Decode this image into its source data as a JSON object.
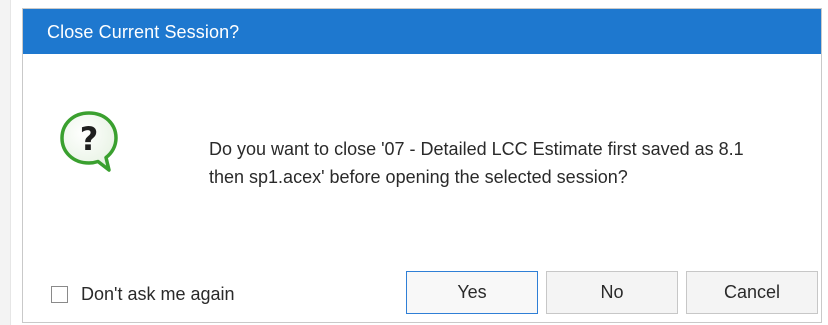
{
  "dialog": {
    "title": "Close Current Session?",
    "message": "Do you want to close '07 - Detailed LCC Estimate first saved as 8.1 then sp1.acex' before opening the selected session?",
    "checkbox_label": "Don't ask me again",
    "checkbox_checked": false,
    "buttons": {
      "yes": "Yes",
      "no": "No",
      "cancel": "Cancel"
    },
    "icon": "question-icon",
    "colors": {
      "titlebar": "#1e78cf",
      "title_text": "#ffffff",
      "icon_green": "#3aa02f",
      "default_button_border": "#2f7fd6"
    }
  }
}
